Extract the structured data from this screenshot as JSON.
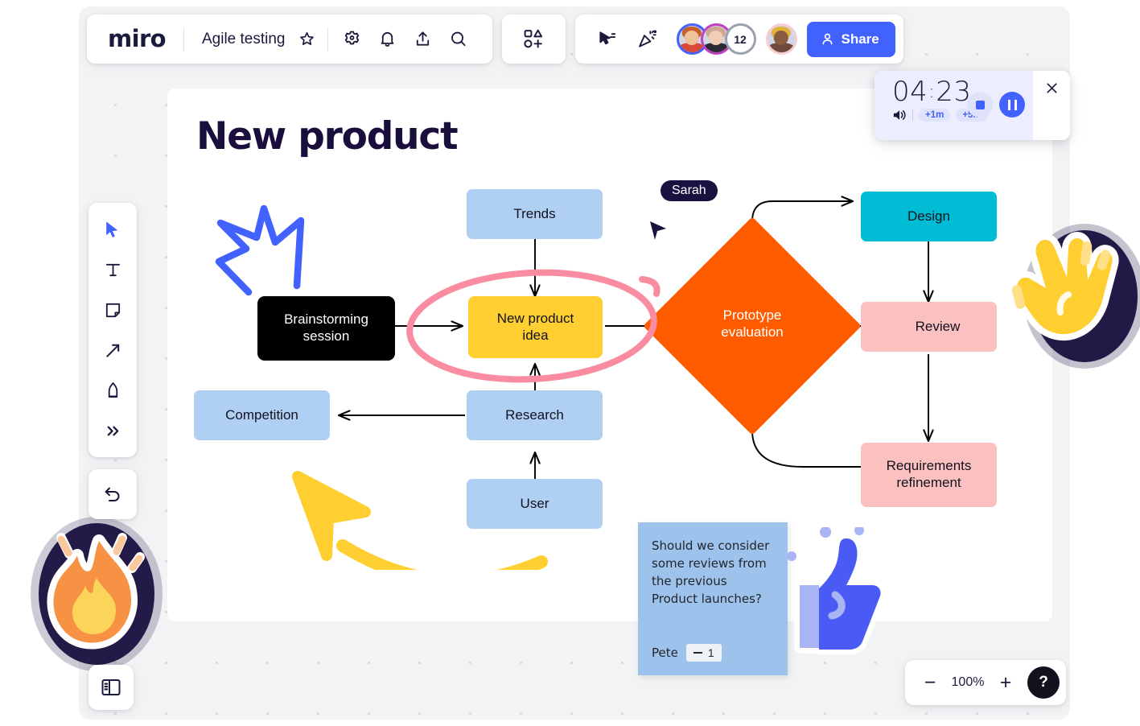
{
  "header": {
    "logo": "miro",
    "board_name": "Agile testing",
    "icons": {
      "star": "star-icon",
      "settings": "gear-icon",
      "notifications": "bell-icon",
      "upload": "upload-icon",
      "search": "search-icon",
      "shapes": "shapes-add-icon",
      "presentation": "cursor-select-icon",
      "celebrate": "party-popper-icon"
    },
    "collaborators": [
      {
        "name": "collaborator-1",
        "ring": "#4262ff"
      },
      {
        "name": "collaborator-2",
        "ring": "#c13fc1"
      },
      {
        "name": "collaborator-count",
        "ring": "#9aa0ad",
        "count": "12"
      },
      {
        "name": "collaborator-4",
        "ring": "#f6cdd4"
      }
    ],
    "share_label": "Share"
  },
  "timer": {
    "minutes": "04",
    "separator": ":",
    "seconds": "23",
    "add_one": "+1m",
    "add_five": "+5m",
    "volume_icon": "volume-icon",
    "stop_icon": "stop-icon",
    "pause_icon": "pause-icon",
    "close_icon": "close-icon"
  },
  "toolbar": {
    "tools": [
      {
        "name": "select-tool",
        "icon": "cursor-icon",
        "active": true
      },
      {
        "name": "text-tool",
        "icon": "text-icon",
        "active": false
      },
      {
        "name": "sticky-note-tool",
        "icon": "sticky-note-icon",
        "active": false
      },
      {
        "name": "arrow-tool",
        "icon": "arrow-icon",
        "active": false
      },
      {
        "name": "pen-tool",
        "icon": "pen-icon",
        "active": false
      },
      {
        "name": "more-tools",
        "icon": "chevron-double-right-icon",
        "active": false
      }
    ],
    "undo": {
      "name": "undo-tool",
      "icon": "undo-icon"
    },
    "panel_toggle": {
      "name": "panel-toggle",
      "icon": "sidebar-panel-icon"
    }
  },
  "zoom": {
    "minus": "−",
    "value": "100%",
    "plus": "+",
    "help": "?"
  },
  "canvas": {
    "title": "New product",
    "cursor_label": "Sarah",
    "nodes": [
      {
        "id": "brainstorming",
        "label": "Brainstorming\nsession",
        "color": "#000000",
        "text_color": "#ffffff"
      },
      {
        "id": "trends",
        "label": "Trends",
        "color": "#afd0f2",
        "text_color": "#12121f"
      },
      {
        "id": "new-product-idea",
        "label": "New product\nidea",
        "color": "#ffce31",
        "text_color": "#12121f"
      },
      {
        "id": "competition",
        "label": "Competition",
        "color": "#afd0f2",
        "text_color": "#12121f"
      },
      {
        "id": "research",
        "label": "Research",
        "color": "#afd0f2",
        "text_color": "#12121f"
      },
      {
        "id": "user",
        "label": "User",
        "color": "#afd0f2",
        "text_color": "#12121f"
      },
      {
        "id": "prototype-evaluation",
        "label": "Prototype\nevaluation",
        "color": "#ff5c00",
        "text_color": "#ffffff"
      },
      {
        "id": "design",
        "label": "Design",
        "color": "#00bcd4",
        "text_color": "#12121f"
      },
      {
        "id": "review",
        "label": "Review",
        "color": "#fbc0c0",
        "text_color": "#12121f"
      },
      {
        "id": "requirements-refinement",
        "label": "Requirements\nrefinement",
        "color": "#fbc0c0",
        "text_color": "#12121f"
      }
    ],
    "labels": {
      "brainstorming_l1": "Brainstorming",
      "brainstorming_l2": "session",
      "trends": "Trends",
      "idea_l1": "New product",
      "idea_l2": "idea",
      "competition": "Competition",
      "research": "Research",
      "user": "User",
      "proto_l1": "Prototype",
      "proto_l2": "evaluation",
      "design": "Design",
      "review": "Review",
      "req_l1": "Requirements",
      "req_l2": "refinement"
    },
    "annotations": {
      "crown_scribble_color": "#4262ff",
      "ellipse_highlight_color": "#f98ca0",
      "yellow_arrow_color": "#ffce31"
    },
    "sticky": {
      "text": "Should we consider some reviews from the previous Product launches?",
      "author": "Pete",
      "vote_count": "1",
      "color": "#9dc2ec"
    },
    "stickers": [
      {
        "name": "fire-sticker",
        "emoji": "🔥"
      },
      {
        "name": "clapping-hand-sticker",
        "emoji": "👏"
      },
      {
        "name": "thumbs-up-sticker",
        "emoji": "👍"
      }
    ]
  }
}
